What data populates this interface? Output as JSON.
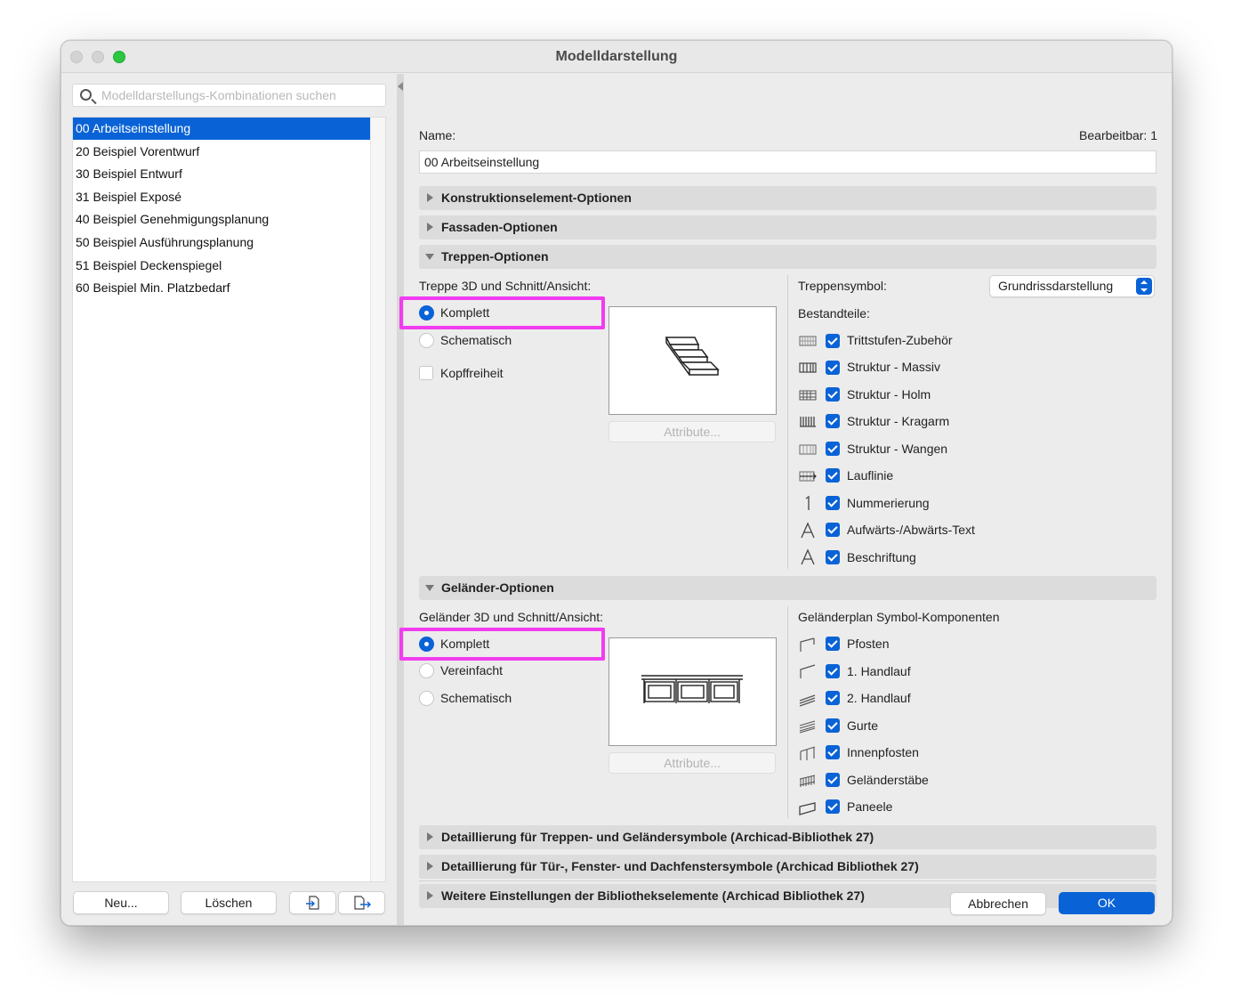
{
  "window": {
    "title": "Modelldarstellung"
  },
  "search": {
    "placeholder": "Modelldarstellungs-Kombinationen suchen",
    "value": ""
  },
  "list": {
    "items": [
      {
        "label": "00 Arbeitseinstellung",
        "selected": true
      },
      {
        "label": "20 Beispiel Vorentwurf"
      },
      {
        "label": "30 Beispiel Entwurf"
      },
      {
        "label": "31 Beispiel Exposé"
      },
      {
        "label": "40 Beispiel Genehmigungsplanung"
      },
      {
        "label": "50 Beispiel Ausführungsplanung"
      },
      {
        "label": "51 Beispiel Deckenspiegel"
      },
      {
        "label": "60 Beispiel Min. Platzbedarf"
      }
    ]
  },
  "left_buttons": {
    "new": "Neu...",
    "delete": "Löschen",
    "import_icon": "import-icon",
    "export_icon": "export-icon"
  },
  "header": {
    "name_label": "Name:",
    "editable_label": "Bearbeitbar: 1",
    "name_value": "00 Arbeitseinstellung"
  },
  "sections": {
    "construction": "Konstruktionselement-Optionen",
    "facade": "Fassaden-Optionen",
    "stairs": "Treppen-Optionen",
    "railing": "Geländer-Optionen",
    "detail_stair": "Detaillierung für Treppen- und Geländersymbole (Archicad-Bibliothek 27)",
    "detail_door": "Detaillierung für Tür-, Fenster- und Dachfenstersymbole (Archicad Bibliothek 27)",
    "more": "Weitere Einstellungen der Bibliothekselemente (Archicad Bibliothek 27)"
  },
  "stairs": {
    "group_label": "Treppe 3D und Schnitt/Ansicht:",
    "options": [
      "Komplett",
      "Schematisch"
    ],
    "selected": "Komplett",
    "headroom": "Kopffreiheit",
    "attr_button": "Attribute...",
    "symbol_label": "Treppensymbol:",
    "symbol_value": "Grundrissdarstellung",
    "components_label": "Bestandteile:",
    "components": [
      {
        "label": "Trittstufen-Zubehör",
        "checked": true,
        "icon": "tread-accessory-icon"
      },
      {
        "label": "Struktur - Massiv",
        "checked": true,
        "icon": "structure-solid-icon"
      },
      {
        "label": "Struktur - Holm",
        "checked": true,
        "icon": "structure-beam-icon"
      },
      {
        "label": "Struktur - Kragarm",
        "checked": true,
        "icon": "structure-cantilever-icon"
      },
      {
        "label": "Struktur - Wangen",
        "checked": true,
        "icon": "structure-stringer-icon"
      },
      {
        "label": "Lauflinie",
        "checked": true,
        "icon": "walking-line-icon"
      },
      {
        "label": "Nummerierung",
        "checked": true,
        "icon": "numbering-icon"
      },
      {
        "label": "Aufwärts-/Abwärts-Text",
        "checked": true,
        "icon": "text-a-icon"
      },
      {
        "label": "Beschriftung",
        "checked": true,
        "icon": "label-a-icon"
      }
    ]
  },
  "railing": {
    "group_label": "Geländer 3D und Schnitt/Ansicht:",
    "options": [
      "Komplett",
      "Vereinfacht",
      "Schematisch"
    ],
    "selected": "Komplett",
    "attr_button": "Attribute...",
    "components_label": "Geländerplan Symbol-Komponenten",
    "components": [
      {
        "label": "Pfosten",
        "checked": true,
        "icon": "post-icon"
      },
      {
        "label": "1. Handlauf",
        "checked": true,
        "icon": "handrail-1-icon"
      },
      {
        "label": "2. Handlauf",
        "checked": true,
        "icon": "handrail-2-icon"
      },
      {
        "label": "Gurte",
        "checked": true,
        "icon": "rails-icon"
      },
      {
        "label": "Innenpfosten",
        "checked": true,
        "icon": "inner-post-icon"
      },
      {
        "label": "Geländerstäbe",
        "checked": true,
        "icon": "balusters-icon"
      },
      {
        "label": "Paneele",
        "checked": true,
        "icon": "panels-icon"
      }
    ]
  },
  "footer": {
    "cancel": "Abbrechen",
    "ok": "OK"
  },
  "colors": {
    "accent": "#0a63d6",
    "highlight": "#f13cf0"
  }
}
